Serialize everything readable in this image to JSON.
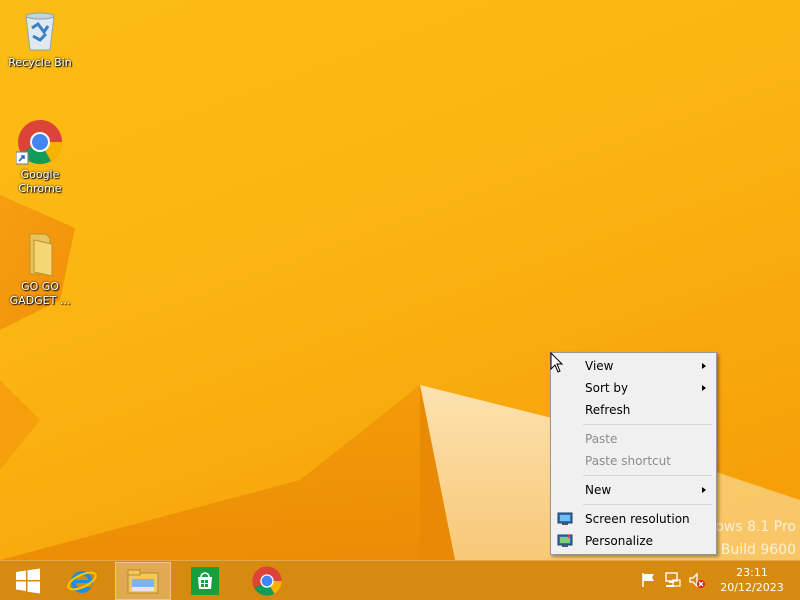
{
  "desktop": {
    "icons": [
      {
        "label": "Recycle Bin",
        "icon": "recycle-bin-icon"
      },
      {
        "label": "Google Chrome",
        "icon": "chrome-icon"
      },
      {
        "label": "GO GO GADGET ...",
        "icon": "folder-icon"
      }
    ],
    "watermark": {
      "line1": "ows 8.1 Pro",
      "line2": "Build 9600"
    }
  },
  "context_menu": {
    "items": [
      {
        "label": "View",
        "submenu": true,
        "enabled": true
      },
      {
        "label": "Sort by",
        "submenu": true,
        "enabled": true
      },
      {
        "label": "Refresh",
        "submenu": false,
        "enabled": true
      },
      {
        "label": "Paste",
        "submenu": false,
        "enabled": false
      },
      {
        "label": "Paste shortcut",
        "submenu": false,
        "enabled": false
      },
      {
        "label": "New",
        "submenu": true,
        "enabled": true
      },
      {
        "label": "Screen resolution",
        "submenu": false,
        "enabled": true,
        "icon": "screen-resolution-icon"
      },
      {
        "label": "Personalize",
        "submenu": false,
        "enabled": true,
        "icon": "personalize-icon"
      }
    ]
  },
  "taskbar": {
    "buttons": [
      {
        "icon": "windows-start-icon"
      },
      {
        "icon": "internet-explorer-icon"
      },
      {
        "icon": "file-explorer-icon",
        "active": true
      },
      {
        "icon": "store-icon"
      },
      {
        "icon": "chrome-icon"
      }
    ],
    "tray": {
      "icons": [
        "action-center-flag-icon",
        "network-icon",
        "volume-muted-icon"
      ],
      "time": "23:11",
      "date": "20/12/2023"
    }
  },
  "colors": {
    "wallpaper": "#fbb512",
    "taskbar": "#d68a10",
    "menu_bg": "#f0f0f0",
    "disabled_text": "#8d8d8d"
  }
}
